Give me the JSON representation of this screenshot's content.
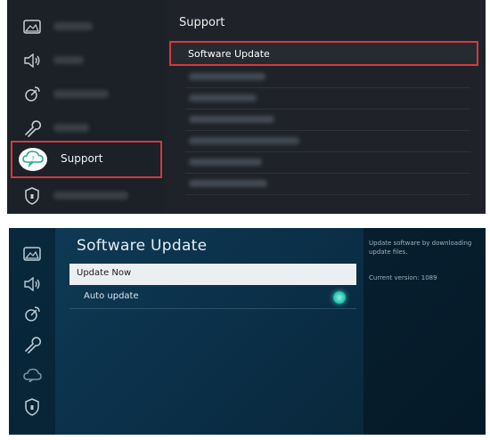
{
  "support_menu": {
    "sidebar": {
      "support_label": "Support"
    },
    "submenu": {
      "title": "Support",
      "highlighted_item": "Software Update"
    },
    "highlight_color": "#d33a3f"
  },
  "software_update": {
    "title": "Software Update",
    "items": [
      {
        "label": "Update Now"
      },
      {
        "label": "Auto update",
        "toggle_on": true
      }
    ],
    "info": {
      "description": "Update software by downloading update files.",
      "version": "Current version: 1089"
    },
    "accent_color": "#31d2bb"
  }
}
